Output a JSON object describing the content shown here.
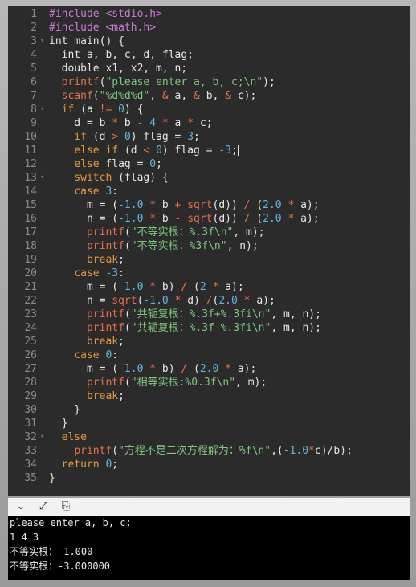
{
  "colors": {
    "text": "#e6e6e6",
    "preprocessor": "#cc7ad6",
    "keyword": "#e79a3c",
    "function": "#e8704a",
    "string": "#7ec87e",
    "number": "#5fb8e0",
    "operator": "#e8704a",
    "comment": "#8a8a8a"
  },
  "code": [
    {
      "n": "1",
      "fold": "",
      "tokens": [
        {
          "t": "#include <stdio.h>",
          "c": "preprocessor"
        }
      ]
    },
    {
      "n": "2",
      "fold": "",
      "tokens": [
        {
          "t": "#include <math.h>",
          "c": "preprocessor"
        }
      ]
    },
    {
      "n": "3",
      "fold": "▾",
      "tokens": [
        {
          "t": "int main() {",
          "c": "text"
        }
      ]
    },
    {
      "n": "4",
      "fold": "",
      "tokens": [
        {
          "t": "  int a, b, c, d, flag;",
          "c": "text"
        }
      ]
    },
    {
      "n": "5",
      "fold": "",
      "tokens": [
        {
          "t": "  double x1, x2, m, n;",
          "c": "text"
        }
      ]
    },
    {
      "n": "6",
      "fold": "",
      "tokens": [
        {
          "t": "  ",
          "c": "text"
        },
        {
          "t": "printf",
          "c": "function"
        },
        {
          "t": "(",
          "c": "text"
        },
        {
          "t": "\"please enter a, b, c;\\n\"",
          "c": "string"
        },
        {
          "t": ");",
          "c": "text"
        }
      ]
    },
    {
      "n": "7",
      "fold": "",
      "tokens": [
        {
          "t": "  ",
          "c": "text"
        },
        {
          "t": "scanf",
          "c": "function"
        },
        {
          "t": "(",
          "c": "text"
        },
        {
          "t": "\"%d%d%d\"",
          "c": "string"
        },
        {
          "t": ", ",
          "c": "text"
        },
        {
          "t": "&",
          "c": "operator"
        },
        {
          "t": " a, ",
          "c": "text"
        },
        {
          "t": "&",
          "c": "operator"
        },
        {
          "t": " b, ",
          "c": "text"
        },
        {
          "t": "&",
          "c": "operator"
        },
        {
          "t": " c);",
          "c": "text"
        }
      ]
    },
    {
      "n": "8",
      "fold": "▾",
      "tokens": [
        {
          "t": "  ",
          "c": "text"
        },
        {
          "t": "if",
          "c": "keyword"
        },
        {
          "t": " (a ",
          "c": "text"
        },
        {
          "t": "!=",
          "c": "operator"
        },
        {
          "t": " ",
          "c": "text"
        },
        {
          "t": "0",
          "c": "number"
        },
        {
          "t": ") {",
          "c": "text"
        }
      ]
    },
    {
      "n": "9",
      "fold": "",
      "tokens": [
        {
          "t": "    d = b ",
          "c": "text"
        },
        {
          "t": "*",
          "c": "operator"
        },
        {
          "t": " b ",
          "c": "text"
        },
        {
          "t": "-",
          "c": "operator"
        },
        {
          "t": " ",
          "c": "text"
        },
        {
          "t": "4",
          "c": "number"
        },
        {
          "t": " ",
          "c": "text"
        },
        {
          "t": "*",
          "c": "operator"
        },
        {
          "t": " a ",
          "c": "text"
        },
        {
          "t": "*",
          "c": "operator"
        },
        {
          "t": " c;",
          "c": "text"
        }
      ]
    },
    {
      "n": "10",
      "fold": "",
      "tokens": [
        {
          "t": "    ",
          "c": "text"
        },
        {
          "t": "if",
          "c": "keyword"
        },
        {
          "t": " (d ",
          "c": "text"
        },
        {
          "t": ">",
          "c": "operator"
        },
        {
          "t": " ",
          "c": "text"
        },
        {
          "t": "0",
          "c": "number"
        },
        {
          "t": ") flag = ",
          "c": "text"
        },
        {
          "t": "3",
          "c": "number"
        },
        {
          "t": ";",
          "c": "text"
        }
      ]
    },
    {
      "n": "11",
      "fold": "",
      "tokens": [
        {
          "t": "    ",
          "c": "text"
        },
        {
          "t": "else if",
          "c": "keyword"
        },
        {
          "t": " (d ",
          "c": "text"
        },
        {
          "t": "<",
          "c": "operator"
        },
        {
          "t": " ",
          "c": "text"
        },
        {
          "t": "0",
          "c": "number"
        },
        {
          "t": ") flag = ",
          "c": "text"
        },
        {
          "t": "-3",
          "c": "number"
        },
        {
          "t": ";",
          "c": "text"
        }
      ]
    },
    {
      "n": "12",
      "fold": "",
      "tokens": [
        {
          "t": "    ",
          "c": "text"
        },
        {
          "t": "else",
          "c": "keyword"
        },
        {
          "t": " flag = ",
          "c": "text"
        },
        {
          "t": "0",
          "c": "number"
        },
        {
          "t": ";",
          "c": "text"
        }
      ]
    },
    {
      "n": "13",
      "fold": "▾",
      "tokens": [
        {
          "t": "    ",
          "c": "text"
        },
        {
          "t": "switch",
          "c": "keyword"
        },
        {
          "t": " (flag) {",
          "c": "text"
        }
      ]
    },
    {
      "n": "14",
      "fold": "",
      "tokens": [
        {
          "t": "    ",
          "c": "text"
        },
        {
          "t": "case",
          "c": "keyword"
        },
        {
          "t": " ",
          "c": "text"
        },
        {
          "t": "3",
          "c": "number"
        },
        {
          "t": ":",
          "c": "text"
        }
      ]
    },
    {
      "n": "15",
      "fold": "",
      "tokens": [
        {
          "t": "      m = (",
          "c": "text"
        },
        {
          "t": "-1.0",
          "c": "number"
        },
        {
          "t": " ",
          "c": "text"
        },
        {
          "t": "*",
          "c": "operator"
        },
        {
          "t": " b ",
          "c": "text"
        },
        {
          "t": "+",
          "c": "operator"
        },
        {
          "t": " ",
          "c": "text"
        },
        {
          "t": "sqrt",
          "c": "function"
        },
        {
          "t": "(d)) ",
          "c": "text"
        },
        {
          "t": "/",
          "c": "operator"
        },
        {
          "t": " (",
          "c": "text"
        },
        {
          "t": "2.0",
          "c": "number"
        },
        {
          "t": " ",
          "c": "text"
        },
        {
          "t": "*",
          "c": "operator"
        },
        {
          "t": " a);",
          "c": "text"
        }
      ]
    },
    {
      "n": "16",
      "fold": "",
      "tokens": [
        {
          "t": "      n = (",
          "c": "text"
        },
        {
          "t": "-1.0",
          "c": "number"
        },
        {
          "t": " ",
          "c": "text"
        },
        {
          "t": "*",
          "c": "operator"
        },
        {
          "t": " b ",
          "c": "text"
        },
        {
          "t": "-",
          "c": "operator"
        },
        {
          "t": " ",
          "c": "text"
        },
        {
          "t": "sqrt",
          "c": "function"
        },
        {
          "t": "(d)) ",
          "c": "text"
        },
        {
          "t": "/",
          "c": "operator"
        },
        {
          "t": " (",
          "c": "text"
        },
        {
          "t": "2.0",
          "c": "number"
        },
        {
          "t": " ",
          "c": "text"
        },
        {
          "t": "*",
          "c": "operator"
        },
        {
          "t": " a);",
          "c": "text"
        }
      ]
    },
    {
      "n": "17",
      "fold": "",
      "tokens": [
        {
          "t": "      ",
          "c": "text"
        },
        {
          "t": "printf",
          "c": "function"
        },
        {
          "t": "(",
          "c": "text"
        },
        {
          "t": "\"不等实根：%.3f\\n\"",
          "c": "string"
        },
        {
          "t": ", m);",
          "c": "text"
        }
      ]
    },
    {
      "n": "18",
      "fold": "",
      "tokens": [
        {
          "t": "      ",
          "c": "text"
        },
        {
          "t": "printf",
          "c": "function"
        },
        {
          "t": "(",
          "c": "text"
        },
        {
          "t": "\"不等实根：%3f\\n\"",
          "c": "string"
        },
        {
          "t": ", n);",
          "c": "text"
        }
      ]
    },
    {
      "n": "19",
      "fold": "",
      "tokens": [
        {
          "t": "      ",
          "c": "text"
        },
        {
          "t": "break",
          "c": "keyword"
        },
        {
          "t": ";",
          "c": "text"
        }
      ]
    },
    {
      "n": "20",
      "fold": "",
      "tokens": [
        {
          "t": "    ",
          "c": "text"
        },
        {
          "t": "case",
          "c": "keyword"
        },
        {
          "t": " ",
          "c": "text"
        },
        {
          "t": "-3",
          "c": "number"
        },
        {
          "t": ":",
          "c": "text"
        }
      ]
    },
    {
      "n": "21",
      "fold": "",
      "tokens": [
        {
          "t": "      m = (",
          "c": "text"
        },
        {
          "t": "-1.0",
          "c": "number"
        },
        {
          "t": " ",
          "c": "text"
        },
        {
          "t": "*",
          "c": "operator"
        },
        {
          "t": " b) ",
          "c": "text"
        },
        {
          "t": "/",
          "c": "operator"
        },
        {
          "t": " (",
          "c": "text"
        },
        {
          "t": "2",
          "c": "number"
        },
        {
          "t": " ",
          "c": "text"
        },
        {
          "t": "*",
          "c": "operator"
        },
        {
          "t": " a);",
          "c": "text"
        }
      ]
    },
    {
      "n": "22",
      "fold": "",
      "tokens": [
        {
          "t": "      n = ",
          "c": "text"
        },
        {
          "t": "sqrt",
          "c": "function"
        },
        {
          "t": "(",
          "c": "text"
        },
        {
          "t": "-1.0",
          "c": "number"
        },
        {
          "t": " ",
          "c": "text"
        },
        {
          "t": "*",
          "c": "operator"
        },
        {
          "t": " d) ",
          "c": "text"
        },
        {
          "t": "/",
          "c": "operator"
        },
        {
          "t": "(",
          "c": "text"
        },
        {
          "t": "2.0",
          "c": "number"
        },
        {
          "t": " ",
          "c": "text"
        },
        {
          "t": "*",
          "c": "operator"
        },
        {
          "t": " a);",
          "c": "text"
        }
      ]
    },
    {
      "n": "23",
      "fold": "",
      "tokens": [
        {
          "t": "      ",
          "c": "text"
        },
        {
          "t": "printf",
          "c": "function"
        },
        {
          "t": "(",
          "c": "text"
        },
        {
          "t": "\"共轭复根：%.3f+%.3fi\\n\"",
          "c": "string"
        },
        {
          "t": ", m, n);",
          "c": "text"
        }
      ]
    },
    {
      "n": "24",
      "fold": "",
      "tokens": [
        {
          "t": "      ",
          "c": "text"
        },
        {
          "t": "printf",
          "c": "function"
        },
        {
          "t": "(",
          "c": "text"
        },
        {
          "t": "\"共轭复根：%.3f-%.3fi\\n\"",
          "c": "string"
        },
        {
          "t": ", m, n);",
          "c": "text"
        }
      ]
    },
    {
      "n": "25",
      "fold": "",
      "tokens": [
        {
          "t": "      ",
          "c": "text"
        },
        {
          "t": "break",
          "c": "keyword"
        },
        {
          "t": ";",
          "c": "text"
        }
      ]
    },
    {
      "n": "26",
      "fold": "",
      "tokens": [
        {
          "t": "    ",
          "c": "text"
        },
        {
          "t": "case",
          "c": "keyword"
        },
        {
          "t": " ",
          "c": "text"
        },
        {
          "t": "0",
          "c": "number"
        },
        {
          "t": ":",
          "c": "text"
        }
      ]
    },
    {
      "n": "27",
      "fold": "",
      "tokens": [
        {
          "t": "      m = (",
          "c": "text"
        },
        {
          "t": "-1.0",
          "c": "number"
        },
        {
          "t": " ",
          "c": "text"
        },
        {
          "t": "*",
          "c": "operator"
        },
        {
          "t": " b) ",
          "c": "text"
        },
        {
          "t": "/",
          "c": "operator"
        },
        {
          "t": " (",
          "c": "text"
        },
        {
          "t": "2.0",
          "c": "number"
        },
        {
          "t": " ",
          "c": "text"
        },
        {
          "t": "*",
          "c": "operator"
        },
        {
          "t": " a);",
          "c": "text"
        }
      ]
    },
    {
      "n": "28",
      "fold": "",
      "tokens": [
        {
          "t": "      ",
          "c": "text"
        },
        {
          "t": "printf",
          "c": "function"
        },
        {
          "t": "(",
          "c": "text"
        },
        {
          "t": "\"相等实根:%0.3f\\n\"",
          "c": "string"
        },
        {
          "t": ", m);",
          "c": "text"
        }
      ]
    },
    {
      "n": "29",
      "fold": "",
      "tokens": [
        {
          "t": "      ",
          "c": "text"
        },
        {
          "t": "break",
          "c": "keyword"
        },
        {
          "t": ";",
          "c": "text"
        }
      ]
    },
    {
      "n": "30",
      "fold": "",
      "tokens": [
        {
          "t": "    }",
          "c": "text"
        }
      ]
    },
    {
      "n": "31",
      "fold": "",
      "tokens": [
        {
          "t": "  }",
          "c": "text"
        }
      ]
    },
    {
      "n": "32",
      "fold": "▾",
      "tokens": [
        {
          "t": "  ",
          "c": "text"
        },
        {
          "t": "else",
          "c": "keyword"
        }
      ]
    },
    {
      "n": "33",
      "fold": "",
      "tokens": [
        {
          "t": "    ",
          "c": "text"
        },
        {
          "t": "printf",
          "c": "function"
        },
        {
          "t": "(",
          "c": "text"
        },
        {
          "t": "\"方程不是二次方程解为：%f\\n\"",
          "c": "string"
        },
        {
          "t": ",(",
          "c": "text"
        },
        {
          "t": "-1.0",
          "c": "number"
        },
        {
          "t": "*",
          "c": "operator"
        },
        {
          "t": "c)/b);",
          "c": "text"
        }
      ]
    },
    {
      "n": "34",
      "fold": "",
      "tokens": [
        {
          "t": "  ",
          "c": "text"
        },
        {
          "t": "return",
          "c": "keyword"
        },
        {
          "t": " ",
          "c": "text"
        },
        {
          "t": "0",
          "c": "number"
        },
        {
          "t": ";",
          "c": "text"
        }
      ]
    },
    {
      "n": "35",
      "fold": "",
      "tokens": [
        {
          "t": "}",
          "c": "text"
        }
      ]
    }
  ],
  "toolbar": {
    "icons": [
      {
        "name": "collapse-chevron-icon",
        "glyph": "⌄"
      },
      {
        "name": "expand-arrows-icon",
        "glyph": "⤢"
      },
      {
        "name": "clear-console-icon",
        "glyph": "⎘"
      }
    ]
  },
  "terminal": {
    "lines": [
      "please enter a, b, c;",
      "1 4 3",
      "不等实根：-1.000",
      "不等实根：-3.000000"
    ]
  }
}
